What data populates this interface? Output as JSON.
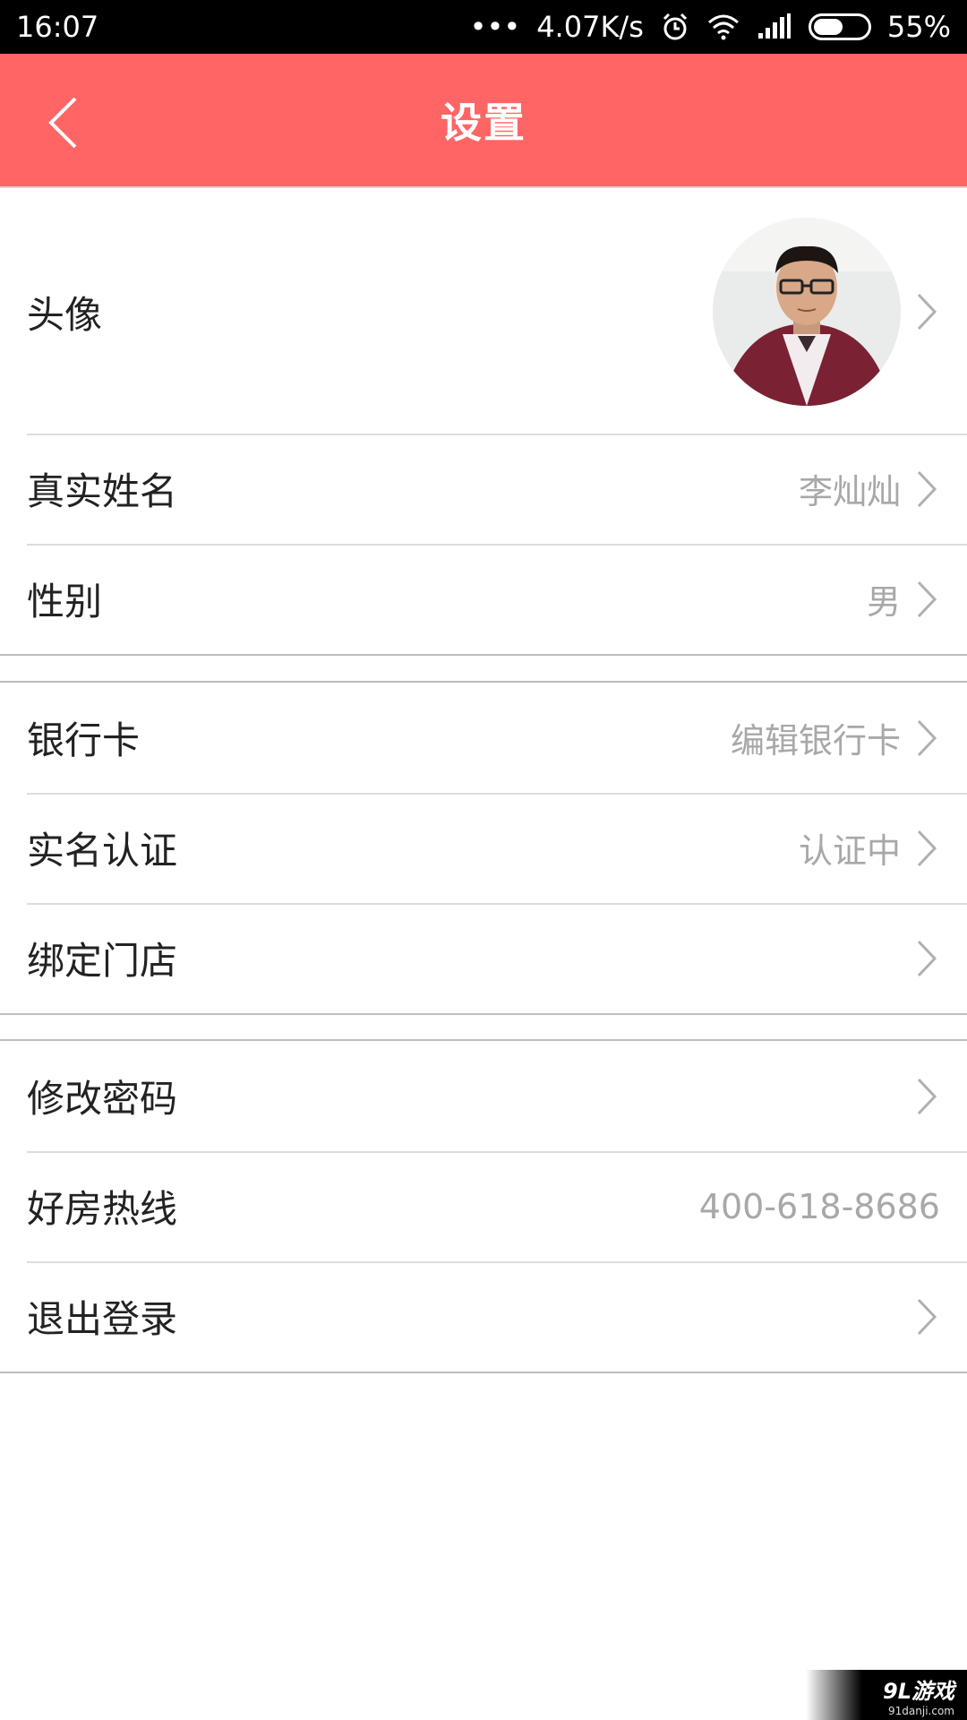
{
  "status_bar": {
    "time": "16:07",
    "dots": "•••",
    "speed": "4.07K/s",
    "battery": "55%",
    "battery_level": 0.55
  },
  "header": {
    "title": "设置"
  },
  "profile_section": {
    "avatar_label": "头像",
    "name_label": "真实姓名",
    "name_value": "李灿灿",
    "gender_label": "性别",
    "gender_value": "男"
  },
  "account_section": {
    "bank_label": "银行卡",
    "bank_value": "编辑银行卡",
    "verify_label": "实名认证",
    "verify_value": "认证中",
    "store_label": "绑定门店"
  },
  "misc_section": {
    "password_label": "修改密码",
    "hotline_label": "好房热线",
    "hotline_value": "400-618-8686",
    "logout_label": "退出登录"
  },
  "watermark": {
    "logo": "9L游戏",
    "site": "91danji.com"
  },
  "colors": {
    "accent": "#ff6565",
    "secondary_text": "#a8a8a8",
    "chevron": "#b0b0b0"
  }
}
